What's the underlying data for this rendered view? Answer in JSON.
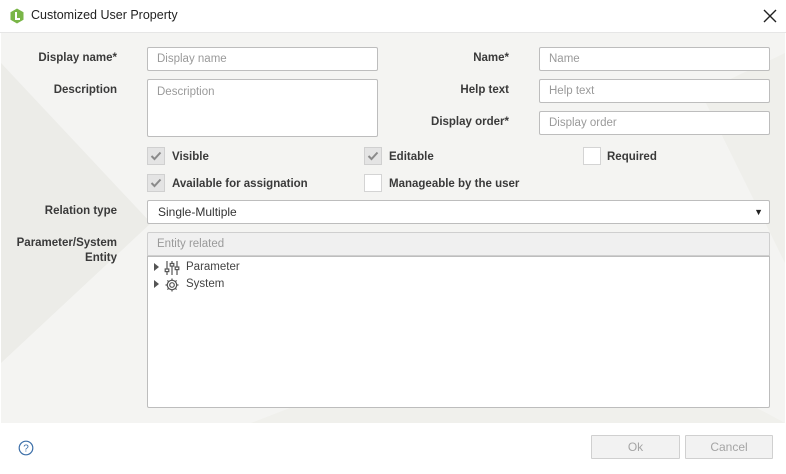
{
  "window": {
    "title": "Customized User Property"
  },
  "form": {
    "display_name": {
      "label": "Display name*",
      "placeholder": "Display name"
    },
    "name": {
      "label": "Name*",
      "placeholder": "Name"
    },
    "description": {
      "label": "Description",
      "placeholder": "Description"
    },
    "help_text": {
      "label": "Help text",
      "placeholder": "Help text"
    },
    "display_order": {
      "label": "Display order*",
      "placeholder": "Display order"
    },
    "checkboxes": {
      "visible": {
        "label": "Visible",
        "checked": true
      },
      "editable": {
        "label": "Editable",
        "checked": true
      },
      "required": {
        "label": "Required",
        "checked": false
      },
      "available_for_assignation": {
        "label": "Available for assignation",
        "checked": true
      },
      "manageable_by_user": {
        "label": "Manageable by the user",
        "checked": false
      }
    },
    "relation_type": {
      "label": "Relation type",
      "value": "Single-Multiple"
    },
    "entity": {
      "label_line1": "Parameter/System",
      "label_line2": "Entity",
      "search_placeholder": "Entity related",
      "tree": [
        {
          "label": "Parameter",
          "icon": "sliders-icon"
        },
        {
          "label": "System",
          "icon": "gear-icon"
        }
      ]
    }
  },
  "footer": {
    "ok_label": "Ok",
    "cancel_label": "Cancel",
    "help_icon": "help-icon"
  },
  "colors": {
    "brand": "#7ab648",
    "accent_bg": "#f4f4f2"
  }
}
